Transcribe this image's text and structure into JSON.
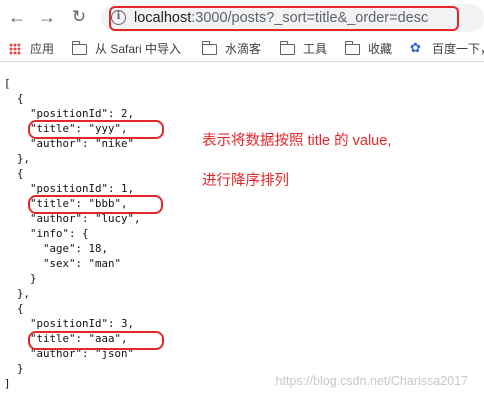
{
  "browser": {
    "url_host": "localhost",
    "url_rest": ":3000/posts?_sort=title&_order=desc",
    "info_glyph": "i"
  },
  "bookmarks": [
    {
      "label": "应用",
      "icon": "apps-icon"
    },
    {
      "label": "从 Safari 中导入",
      "icon": "folder-icon"
    },
    {
      "label": "水滴客",
      "icon": "folder-icon"
    },
    {
      "label": "工具",
      "icon": "folder-icon"
    },
    {
      "label": "收藏",
      "icon": "folder-icon"
    },
    {
      "label": "百度一下，",
      "icon": "paw-icon"
    }
  ],
  "code_lines": [
    "[",
    "  {",
    "    \"positionId\": 2,",
    "    \"title\": \"yyy\",",
    "    \"author\": \"nike\"",
    "  },",
    "  {",
    "    \"positionId\": 1,",
    "    \"title\": \"bbb\",",
    "    \"author\": \"lucy\",",
    "    \"info\": {",
    "      \"age\": 18,",
    "      \"sex\": \"man\"",
    "    }",
    "  },",
    "  {",
    "    \"positionId\": 3,",
    "    \"title\": \"aaa\",",
    "    \"author\": \"json\"",
    "  }",
    "]"
  ],
  "annotation": {
    "line1": "表示将数据按照 title 的 value,",
    "line2": "进行降序排列"
  },
  "watermark": "https://blog.csdn.net/Charissa2017",
  "colors": {
    "highlight": "#e5262b",
    "annotation": "#e5262b"
  }
}
